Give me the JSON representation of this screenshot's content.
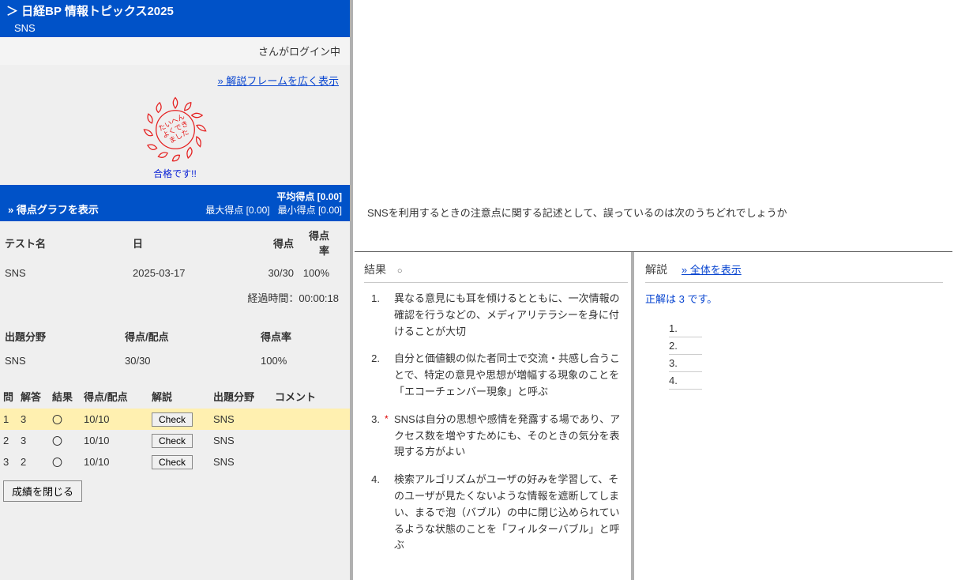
{
  "header": {
    "breadcrumb": "＞ 日経BP 情報トピックス2025",
    "subtitle": "SNS"
  },
  "login_strip": "さんがログイン中",
  "widen_link": "» 解説フレームを広く表示",
  "stamp_caption": "合格です!!",
  "stamp_text_lines": [
    "たいへん",
    "よくでき",
    "ました"
  ],
  "stats_bar": {
    "show_graph": "» 得点グラフを表示",
    "avg_label": "平均得点 [0.00]",
    "max_label": "最大得点 [0.00]",
    "min_label": "最小得点 [0.00]"
  },
  "score_table": {
    "headers": {
      "test": "テスト名",
      "date": "日",
      "score": "得点",
      "rate": "得点率"
    },
    "row": {
      "test": "SNS",
      "date": "2025-03-17",
      "score": "30/30",
      "rate": "100%"
    },
    "elapsed": "経過時間：00:00:18"
  },
  "field_table": {
    "headers": {
      "field": "出題分野",
      "score": "得点/配点",
      "rate": "得点率"
    },
    "row": {
      "field": "SNS",
      "score": "30/30",
      "rate": "100%"
    }
  },
  "answers_table": {
    "headers": {
      "q": "問",
      "ans": "解答",
      "res": "結果",
      "score": "得点/配点",
      "expl": "解説",
      "field": "出題分野",
      "comment": "コメント"
    },
    "rows": [
      {
        "q": "1",
        "ans": "3",
        "res": "〇",
        "score": "10/10",
        "check": "Check",
        "field": "SNS",
        "hl": true
      },
      {
        "q": "2",
        "ans": "3",
        "res": "〇",
        "score": "10/10",
        "check": "Check",
        "field": "SNS",
        "hl": false
      },
      {
        "q": "3",
        "ans": "2",
        "res": "〇",
        "score": "10/10",
        "check": "Check",
        "field": "SNS",
        "hl": false
      }
    ]
  },
  "close_button": "成績を閉じる",
  "question": "SNSを利用するときの注意点に関する記述として、誤っているのは次のうちどれでしょうか",
  "result_pane": {
    "title": "結果",
    "mark": "○",
    "choices": [
      {
        "n": "1.",
        "star": "",
        "text": "異なる意見にも耳を傾けるとともに、一次情報の確認を行うなどの、メディアリテラシーを身に付けることが大切"
      },
      {
        "n": "2.",
        "star": "",
        "text": "自分と価値観の似た者同士で交流・共感し合うことで、特定の意見や思想が増幅する現象のことを「エコーチェンバー現象」と呼ぶ"
      },
      {
        "n": "3.",
        "star": "*",
        "text": "SNSは自分の思想や感情を発露する場であり、アクセス数を増やすためにも、そのときの気分を表現する方がよい"
      },
      {
        "n": "4.",
        "star": "",
        "text": "検索アルゴリズムがユーザの好みを学習して、そのユーザが見たくないような情報を遮断してしまい、まるで泡（バブル）の中に閉じ込められているような状態のことを「フィルターバブル」と呼ぶ"
      }
    ]
  },
  "explain_pane": {
    "title": "解説",
    "show_all": "» 全体を表示",
    "correct": "正解は 3 です。",
    "nums": [
      "1.",
      "2.",
      "3.",
      "4."
    ]
  }
}
